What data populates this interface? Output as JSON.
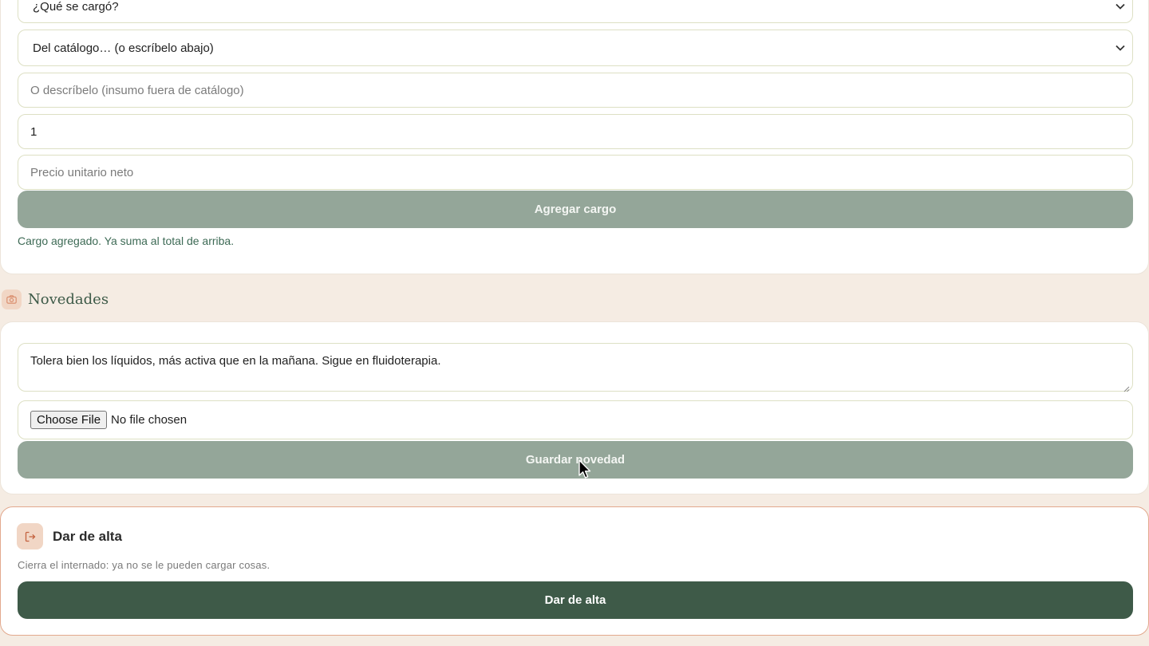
{
  "cargos": {
    "que_se_cargo_select": "¿Qué se cargó?",
    "catalogo_select": "Del catálogo… (o escríbelo abajo)",
    "descripcion_placeholder": "O descríbelo (insumo fuera de catálogo)",
    "cantidad_value": "1",
    "precio_placeholder": "Precio unitario neto",
    "agregar_button": "Agregar cargo",
    "success_message": "Cargo agregado. Ya suma al total de arriba."
  },
  "novedades": {
    "section_title": "Novedades",
    "icon": "camera-icon",
    "textarea_value": "Tolera bien los líquidos, más activa que en la mañana. Sigue en fluidoterapia.",
    "file_button": "Choose File",
    "file_status": "No file chosen",
    "guardar_button": "Guardar novedad"
  },
  "alta": {
    "icon": "logout-icon",
    "title": "Dar de alta",
    "description": "Cierra el internado: ya no se le pueden cargar cosas.",
    "button": "Dar de alta"
  },
  "colors": {
    "background": "#f5ece3",
    "sage_button": "#94a699",
    "dark_green": "#3e5a48",
    "accent_peach": "#f1d6c5",
    "alta_border": "#e2a88d",
    "success_text": "#3d6a55"
  }
}
